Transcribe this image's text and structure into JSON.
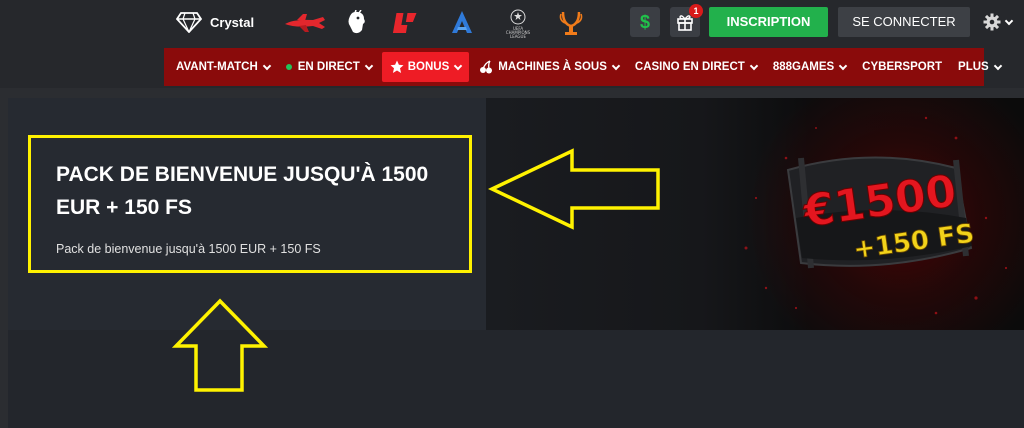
{
  "topbar": {
    "brand_label": "Crystal",
    "register_label": "INSCRIPTION",
    "login_label": "SE CONNECTER",
    "gift_badge_count": "1",
    "dollar_symbol": "$"
  },
  "nav": {
    "items": [
      {
        "label": "AVANT-MATCH"
      },
      {
        "label": "EN DIRECT"
      },
      {
        "label": "BONUS"
      },
      {
        "label": "MACHINES À SOUS"
      },
      {
        "label": "CASINO EN DIRECT"
      },
      {
        "label": "888GAMES"
      },
      {
        "label": "CYBERSPORT"
      },
      {
        "label": "PLUS"
      }
    ]
  },
  "promo": {
    "title": "PACK DE BIENVENUE JUSQU'À 1500 EUR + 150 FS",
    "subtitle": "Pack de bienvenue jusqu'à 1500 EUR + 150 FS",
    "image_amount": "€1500",
    "image_spins": "+150 FS"
  },
  "colors": {
    "accent_green": "#22b14c",
    "nav_red": "#8a0b0b",
    "active_red": "#ee1c25",
    "highlight_yellow": "#fff200"
  },
  "icons": {
    "brand": "diamond-icon",
    "aviator": "plane-icon",
    "premier_league": "lion-icon",
    "laliga": "laliga-icon",
    "serie_a": "serie-a-icon",
    "champions_league": "champions-league-icon",
    "europa_league": "europa-league-icon",
    "settings": "gear-icon"
  },
  "champions_league_caption": "UEFA CHAMPIONS LEAGUE"
}
